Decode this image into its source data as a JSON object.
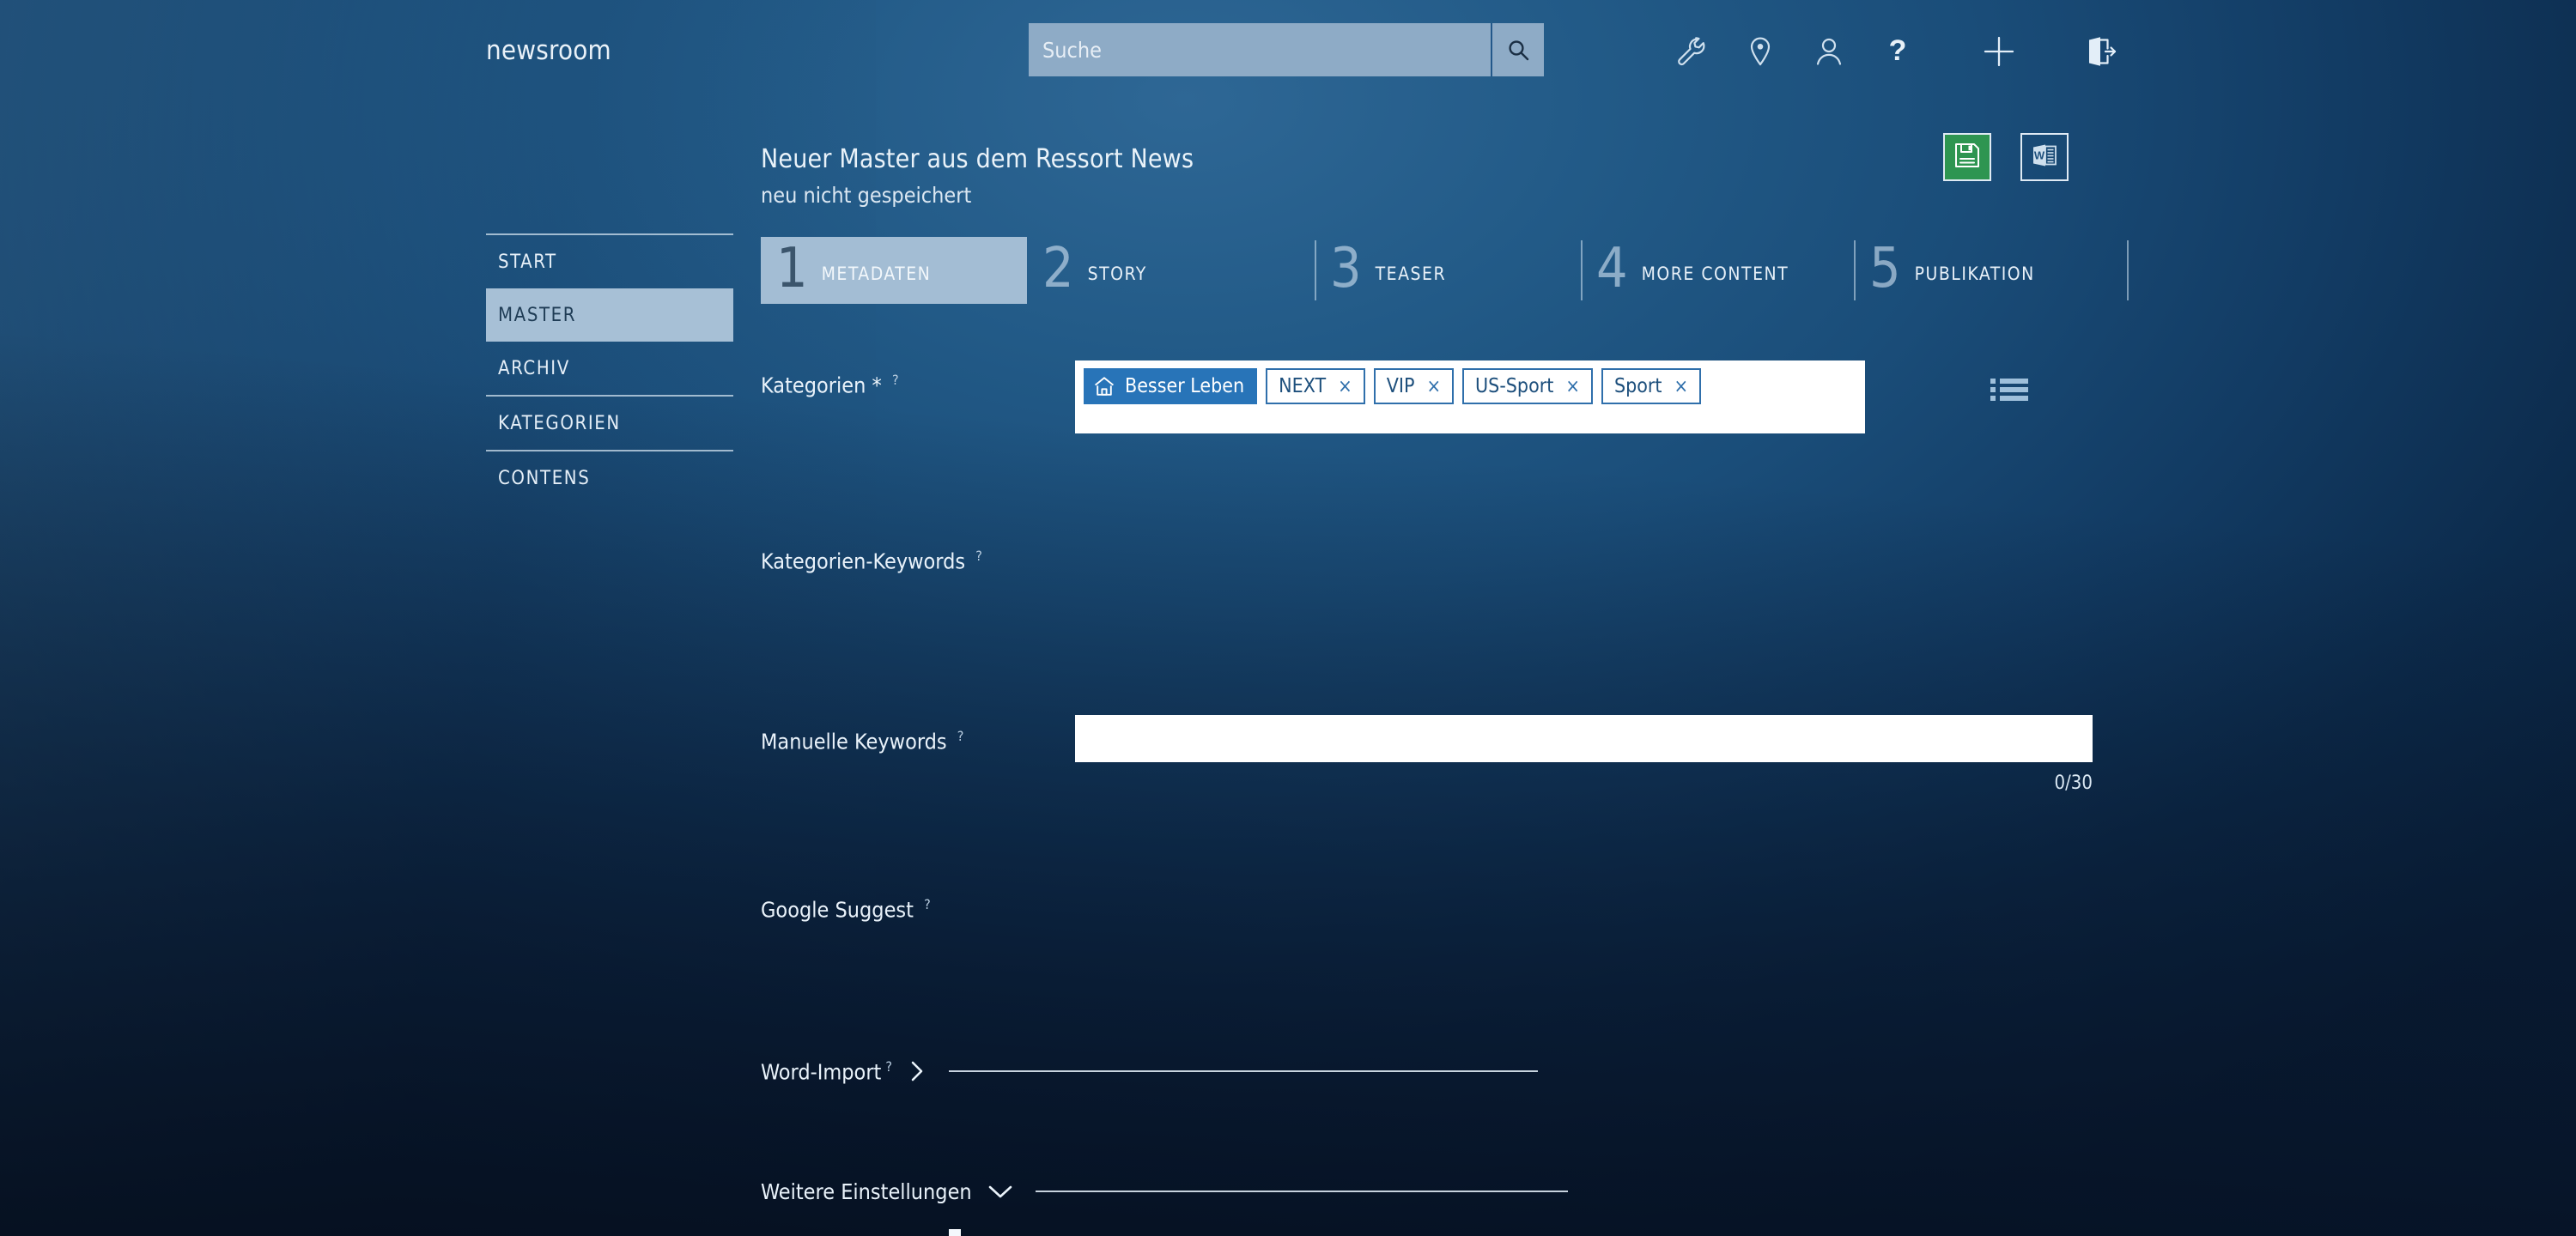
{
  "colors": {
    "accent_blue": "#2874b8",
    "save_green": "#2e9551",
    "active_tab_bg": "#a3bdd4",
    "sidebar_active_bg": "#a7c0d6",
    "field_white": "#ffffff",
    "text_light": "#e9f2fa"
  },
  "topbar": {
    "brand": "newsroom",
    "search": {
      "placeholder": "Suche",
      "value": "",
      "button_icon": "search-icon"
    },
    "icons": [
      {
        "name": "wrench-icon",
        "label": "Werkzeuge"
      },
      {
        "name": "location-pin-icon",
        "label": "Standort"
      },
      {
        "name": "user-icon",
        "label": "Benutzer"
      },
      {
        "name": "question-mark-icon",
        "label": "Hilfe"
      },
      {
        "name": "plus-icon",
        "label": "Neu"
      },
      {
        "name": "logout-icon",
        "label": "Abmelden"
      }
    ]
  },
  "header": {
    "title": "Neuer Master aus dem Ressort News",
    "status": "neu nicht gespeichert",
    "actions": [
      {
        "name": "save-button",
        "icon": "floppy-disk-icon",
        "label": "Speichern"
      },
      {
        "name": "word-export-button",
        "icon": "word-document-icon",
        "label": "Word"
      }
    ]
  },
  "sidebar": {
    "items": [
      {
        "label": "START",
        "active": false
      },
      {
        "label": "MASTER",
        "active": true
      },
      {
        "label": "ARCHIV",
        "active": false
      },
      {
        "label": "KATEGORIEN",
        "active": false
      },
      {
        "label": "CONTENS",
        "active": false
      }
    ]
  },
  "steps": [
    {
      "num": "1",
      "label": "METADATEN",
      "active": true
    },
    {
      "num": "2",
      "label": "STORY",
      "active": false
    },
    {
      "num": "3",
      "label": "TEASER",
      "active": false
    },
    {
      "num": "4",
      "label": "MORE CONTENT",
      "active": false
    },
    {
      "num": "5",
      "label": "PUBLIKATION",
      "active": false
    }
  ],
  "form": {
    "kategorien": {
      "label": "Kategorien",
      "required_mark": "*",
      "help": "?",
      "chips": [
        {
          "text": "Besser Leben",
          "primary": true,
          "icon": "home-icon",
          "removable": false
        },
        {
          "text": "NEXT",
          "primary": false,
          "remove": "×",
          "removable": true
        },
        {
          "text": "VIP",
          "primary": false,
          "remove": "×",
          "removable": true
        },
        {
          "text": "US-Sport",
          "primary": false,
          "remove": "×",
          "removable": true
        },
        {
          "text": "Sport",
          "primary": false,
          "remove": "×",
          "removable": true
        }
      ],
      "list_icon": "list-view-icon"
    },
    "kategorien_keywords": {
      "label": "Kategorien-Keywords",
      "help": "?"
    },
    "manuelle_keywords": {
      "label": "Manuelle Keywords",
      "help": "?",
      "value": "",
      "placeholder": "",
      "counter": "0/30"
    },
    "google_suggest": {
      "label": "Google Suggest",
      "help": "?"
    },
    "word_import": {
      "label": "Word-Import",
      "help": "?",
      "chevron": "chevron-right-icon",
      "expanded": false
    },
    "weitere_einstellungen": {
      "label": "Weitere Einstellungen",
      "chevron": "chevron-down-icon",
      "expanded": false
    }
  }
}
